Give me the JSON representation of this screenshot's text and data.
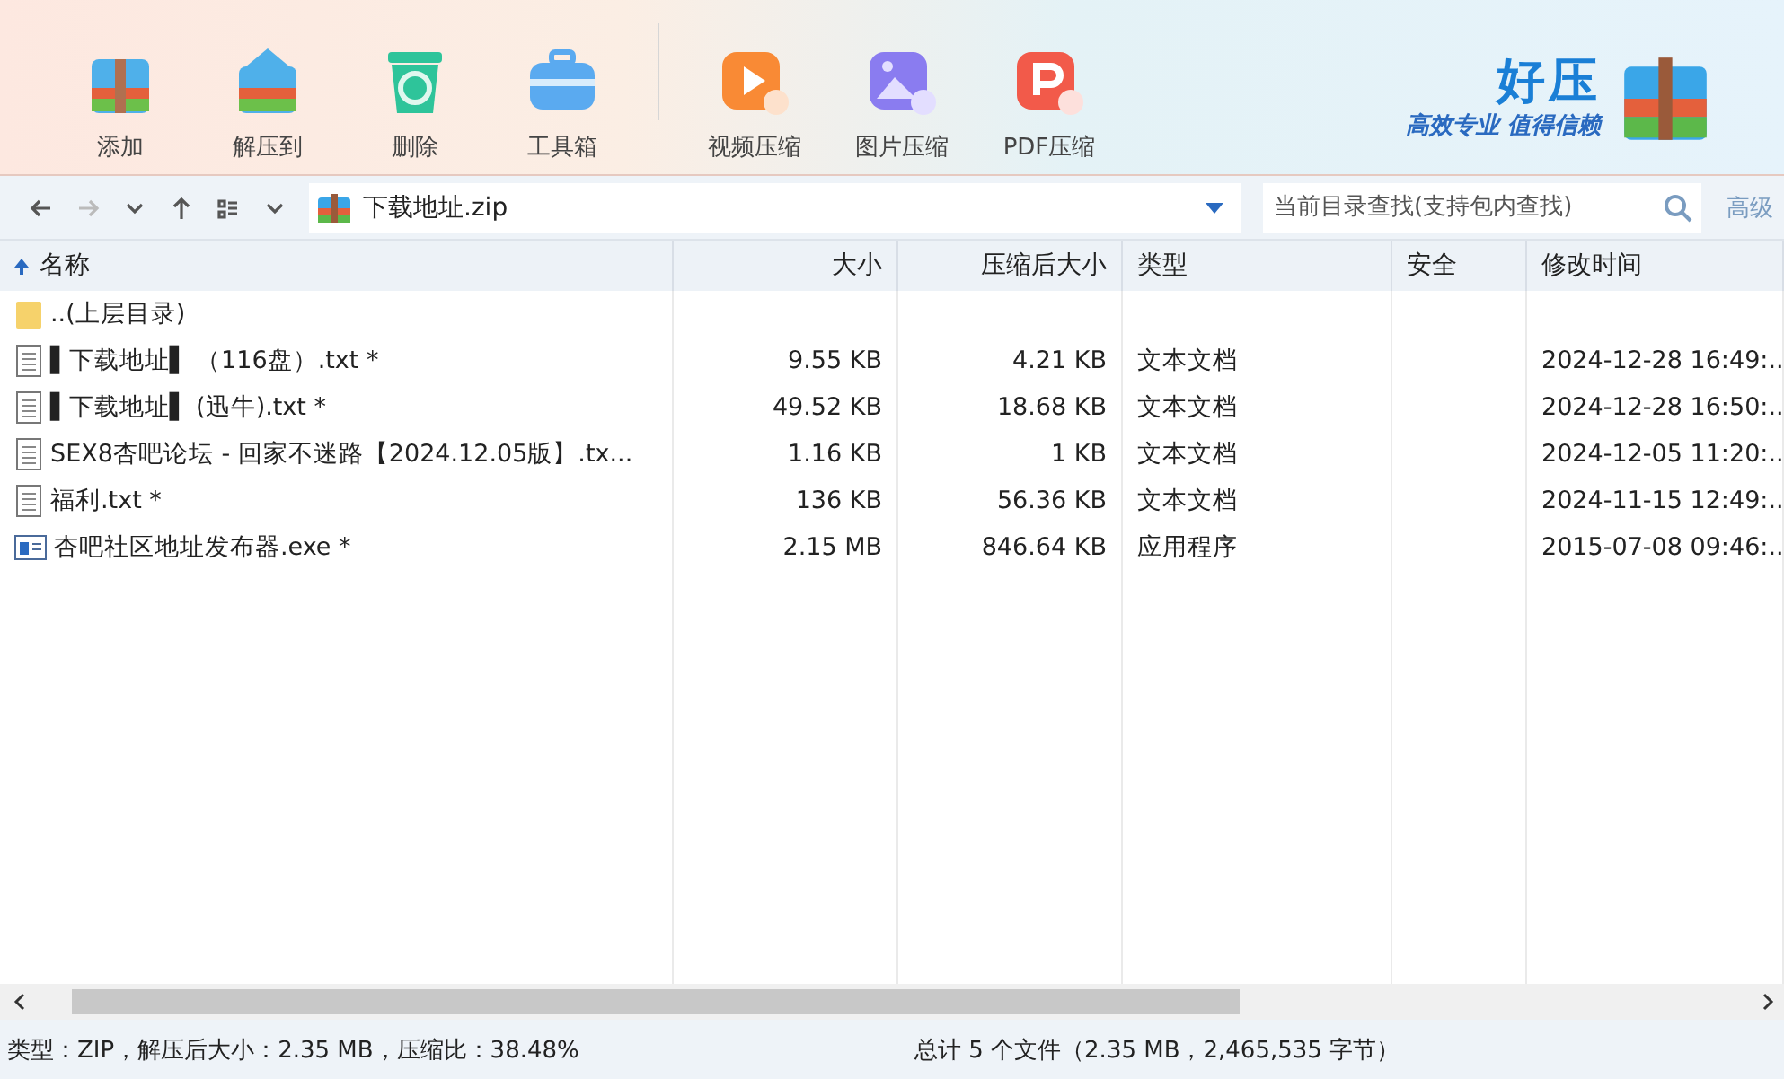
{
  "toolbar": {
    "tools": [
      {
        "label": "添加",
        "kind": "add"
      },
      {
        "label": "解压到",
        "kind": "extract"
      },
      {
        "label": "删除",
        "kind": "delete"
      },
      {
        "label": "工具箱",
        "kind": "toolbox"
      }
    ],
    "compress_tools": [
      {
        "label": "视频压缩",
        "kind": "video"
      },
      {
        "label": "图片压缩",
        "kind": "image"
      },
      {
        "label": "PDF压缩",
        "kind": "pdf"
      }
    ],
    "brand": {
      "name": "好压",
      "slogan": "高效专业 值得信赖"
    }
  },
  "navbar": {
    "path": "下载地址.zip",
    "search_placeholder": "当前目录查找(支持包内查找)",
    "advanced": "高级"
  },
  "table": {
    "columns": [
      {
        "label": "名称",
        "sorted": true
      },
      {
        "label": "大小",
        "sorted": false
      },
      {
        "label": "压缩后大小",
        "sorted": false
      },
      {
        "label": "类型",
        "sorted": false
      },
      {
        "label": "安全",
        "sorted": false
      },
      {
        "label": "修改时间",
        "sorted": false
      }
    ],
    "rows": [
      {
        "kind": "folder",
        "name": "..(上层目录)",
        "size": "",
        "packed": "",
        "type": "",
        "modified": ""
      },
      {
        "kind": "text",
        "name": "▌下载地址▌ （116盘）.txt *",
        "size": "9.55 KB",
        "packed": "4.21 KB",
        "type": "文本文档",
        "modified": "2024-12-28 16:49:.."
      },
      {
        "kind": "text",
        "name": "▌下载地址▌ (迅牛).txt *",
        "size": "49.52 KB",
        "packed": "18.68 KB",
        "type": "文本文档",
        "modified": "2024-12-28 16:50:.."
      },
      {
        "kind": "text",
        "name": "SEX8杏吧论坛 - 回家不迷路【2024.12.05版】.tx...",
        "size": "1.16 KB",
        "packed": "1 KB",
        "type": "文本文档",
        "modified": "2024-12-05 11:20:.."
      },
      {
        "kind": "text",
        "name": "福利.txt *",
        "size": "136 KB",
        "packed": "56.36 KB",
        "type": "文本文档",
        "modified": "2024-11-15 12:49:.."
      },
      {
        "kind": "exe",
        "name": "杏吧社区地址发布器.exe *",
        "size": "2.15 MB",
        "packed": "846.64 KB",
        "type": "应用程序",
        "modified": "2015-07-08 09:46:.."
      }
    ]
  },
  "status_bar": {
    "left": "类型：ZIP，解压后大小：2.35 MB，压缩比：38.48%",
    "right": "总计 5 个文件（2.35 MB，2,465,535 字节）"
  }
}
